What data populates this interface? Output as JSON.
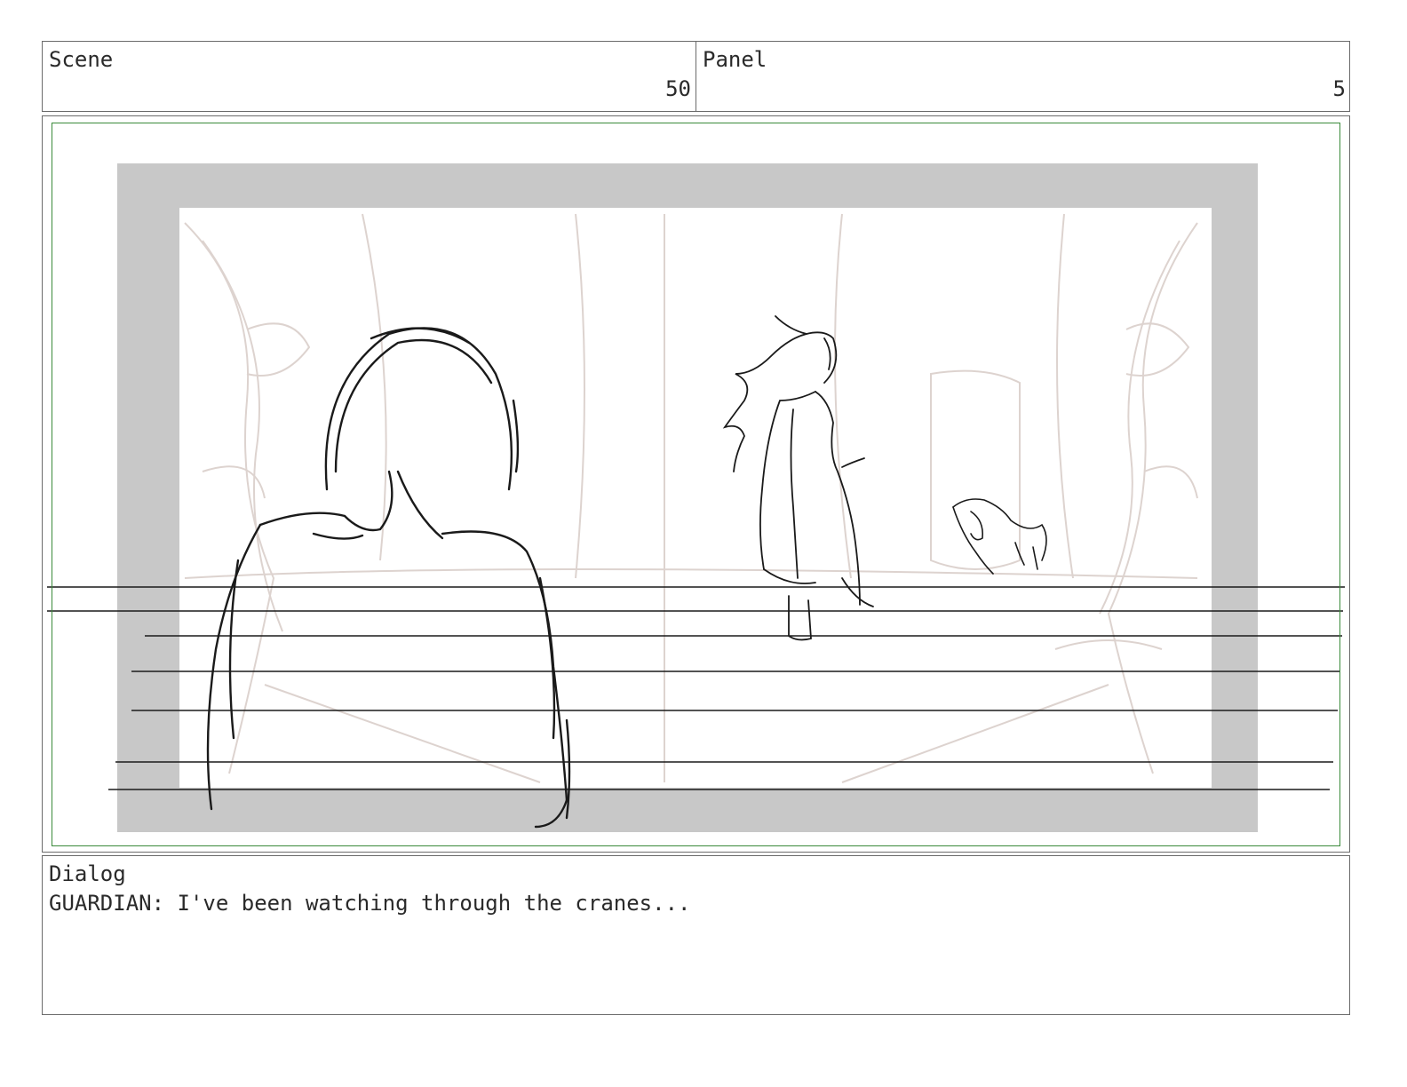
{
  "header": {
    "scene_label": "Scene",
    "scene_number": "50",
    "panel_label": "Panel",
    "panel_number": "5"
  },
  "frame": {
    "safe_area_color": "#3a8a3a",
    "letterbox_color": "#c8c8c8",
    "sketch_color": "#111111",
    "background_sketch_color": "#d9cfcb"
  },
  "dialog": {
    "label": "Dialog",
    "text": "GUARDIAN: I've been watching through the cranes..."
  }
}
